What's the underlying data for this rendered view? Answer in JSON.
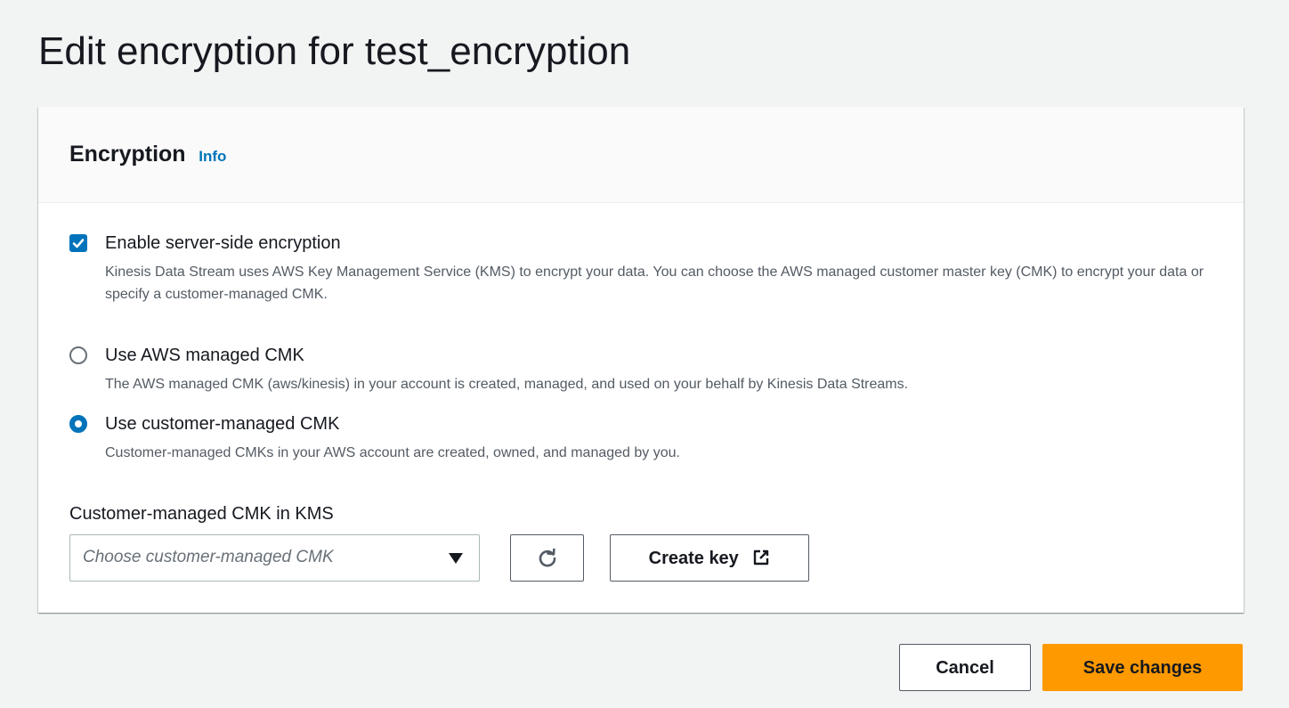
{
  "page": {
    "title": "Edit encryption for test_encryption"
  },
  "encryption_panel": {
    "heading": "Encryption",
    "info_link": "Info"
  },
  "options": {
    "enable_sse": {
      "label": "Enable server-side encryption",
      "description": "Kinesis Data Stream uses AWS Key Management Service (KMS) to encrypt your data. You can choose the AWS managed customer master key (CMK) to encrypt your data or specify a customer-managed CMK.",
      "checked": true
    },
    "aws_managed": {
      "label": "Use AWS managed CMK",
      "description": "The AWS managed CMK (aws/kinesis) in your account is created, managed, and used on your behalf by Kinesis Data Streams.",
      "selected": false
    },
    "customer_managed": {
      "label": "Use customer-managed CMK",
      "description": "Customer-managed CMKs in your AWS account are created, owned, and managed by you.",
      "selected": true
    }
  },
  "cmk_field": {
    "label": "Customer-managed CMK in KMS",
    "placeholder": "Choose customer-managed CMK",
    "value": "",
    "refresh_icon": "refresh-icon",
    "create_key_label": "Create key",
    "create_key_icon": "external-link-icon"
  },
  "footer": {
    "cancel_label": "Cancel",
    "save_label": "Save changes"
  },
  "colors": {
    "accent": "#0073bb",
    "primary_button": "#ff9900",
    "background": "#f2f3f3",
    "panel_header": "#fafafa",
    "text": "#16191f",
    "muted_text": "#545b64"
  }
}
